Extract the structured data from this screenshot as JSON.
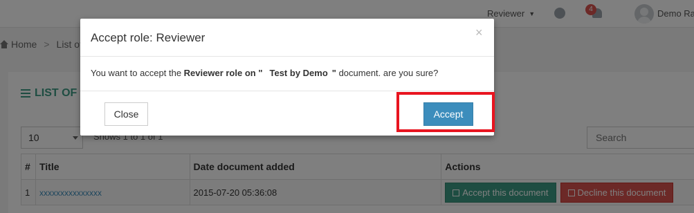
{
  "header": {
    "role_label": "Reviewer",
    "notification_count": "4",
    "user_name": "Demo Ra"
  },
  "breadcrumb": {
    "home": "Home",
    "current": "List of"
  },
  "panel": {
    "title": "LIST OF D",
    "page_length": "10",
    "info": "Shows 1 to 1 of 1",
    "search_placeholder": "Search"
  },
  "table": {
    "headers": [
      "#",
      "Title",
      "Date document added",
      "Actions"
    ],
    "rows": [
      {
        "num": "1",
        "title": "xxxxxxxxxxxxxxx",
        "date": "2015-07-20 05:36:08",
        "accept_label": "Accept this document",
        "decline_label": "Decline this document"
      }
    ]
  },
  "modal": {
    "title": "Accept role: Reviewer",
    "close_glyph": "×",
    "body_prefix": "You want to accept the ",
    "role": "Reviewer",
    "body_middle": " role on \"",
    "document_name": "Test by Demo",
    "body_suffix": "\" document. are you sure?",
    "close_button": "Close",
    "accept_button": "Accept"
  },
  "colors": {
    "accent_teal": "#3c9b84",
    "primary_blue": "#3c8dbc",
    "danger_red": "#d9534f",
    "highlight_red": "#e8141f"
  }
}
